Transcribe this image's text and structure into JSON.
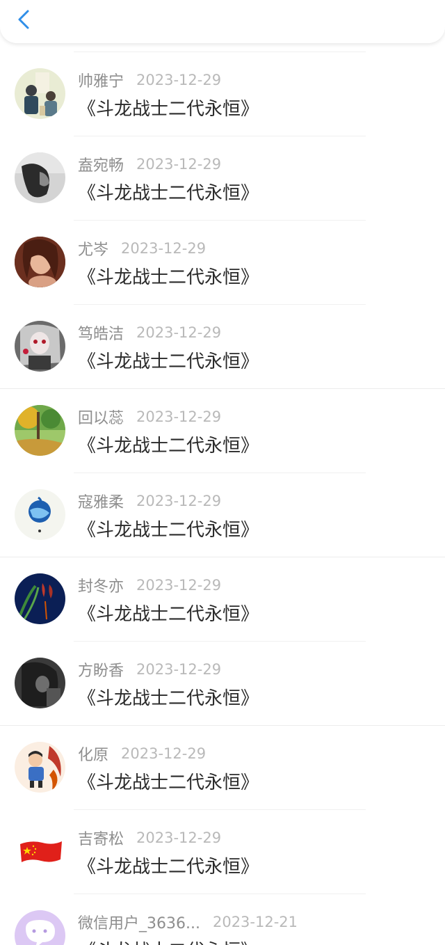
{
  "header": {
    "back_icon": "chevron-left-icon",
    "accent_color": "#2f8ee8"
  },
  "items": [
    {
      "name": "帅雅宁",
      "date": "2023-12-29",
      "title": "《斗龙战士二代永恒》"
    },
    {
      "name": "盍宛畅",
      "date": "2023-12-29",
      "title": "《斗龙战士二代永恒》"
    },
    {
      "name": "尤岑",
      "date": "2023-12-29",
      "title": "《斗龙战士二代永恒》"
    },
    {
      "name": "笃皓洁",
      "date": "2023-12-29",
      "title": "《斗龙战士二代永恒》"
    },
    {
      "name": "回以蕊",
      "date": "2023-12-29",
      "title": "《斗龙战士二代永恒》"
    },
    {
      "name": "寇雅柔",
      "date": "2023-12-29",
      "title": "《斗龙战士二代永恒》"
    },
    {
      "name": "封冬亦",
      "date": "2023-12-29",
      "title": "《斗龙战士二代永恒》"
    },
    {
      "name": "方盼香",
      "date": "2023-12-29",
      "title": "《斗龙战士二代永恒》"
    },
    {
      "name": "化原",
      "date": "2023-12-29",
      "title": "《斗龙战士二代永恒》"
    },
    {
      "name": "吉寄松",
      "date": "2023-12-29",
      "title": "《斗龙战士二代永恒》"
    },
    {
      "name": "微信用户_3636...",
      "date": "2023-12-21",
      "title": "《斗龙战士二代永恒》"
    }
  ]
}
